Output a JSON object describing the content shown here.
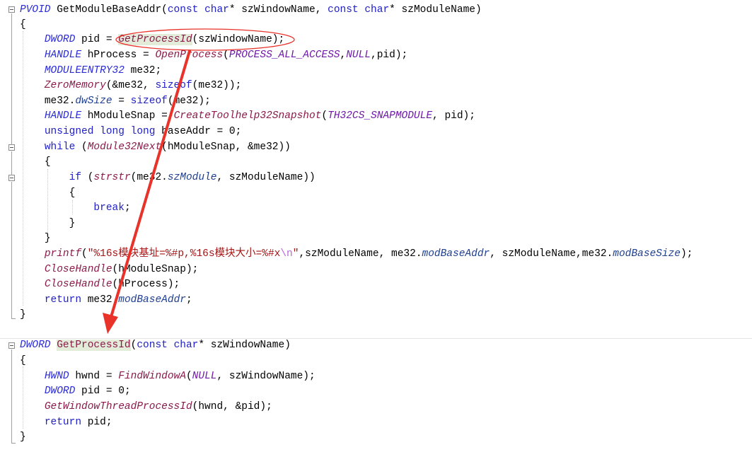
{
  "code": {
    "func1": {
      "sig": {
        "ret": "PVOID",
        "name": "GetModuleBaseAddr",
        "p1": "(",
        "kw_const1": "const",
        "kw_char1": "char",
        "ptr1": "* szWindowName, ",
        "kw_const2": "const",
        "kw_char2": "char",
        "ptr2": "* szModuleName)"
      },
      "open": "{",
      "l1": {
        "type": "DWORD",
        "text1": " pid = ",
        "call": "GetProcessId",
        "text2": "(szWindowName);"
      },
      "l2": {
        "type": "HANDLE",
        "text1": " hProcess = ",
        "call": "OpenProcess",
        "p1": "(",
        "m1": "PROCESS_ALL_ACCESS",
        "p2": ",",
        "m2": "NULL",
        "p3": ",pid);"
      },
      "l3": {
        "type": "MODULEENTRY32",
        "text1": " me32;"
      },
      "l4": {
        "call": "ZeroMemory",
        "text1": "(&me32, ",
        "kw": "sizeof",
        "text2": "(me32));"
      },
      "l5": {
        "text1": "me32.",
        "mem": "dwSize",
        "text2": " = ",
        "kw": "sizeof",
        "text3": "(me32);"
      },
      "l6": {
        "type": "HANDLE",
        "text1": " hModuleSnap = ",
        "call": "CreateToolhelp32Snapshot",
        "p1": "(",
        "m1": "TH32CS_SNAPMODULE",
        "p2": ", pid);"
      },
      "l7": {
        "kw": "unsigned long long",
        "text1": " baseAddr = 0;"
      },
      "l8": {
        "kw": "while",
        "text1": " (",
        "call": "Module32Next",
        "text2": "(hModuleSnap, &me32))"
      },
      "l9": {
        "text": "{"
      },
      "l10": {
        "kw": "if",
        "text1": " (",
        "call": "strstr",
        "text2": "(me32.",
        "mem": "szModule",
        "text3": ", szModuleName))"
      },
      "l11": {
        "text": "{"
      },
      "l12": {
        "kw": "break",
        "text1": ";"
      },
      "l13": {
        "text": "}"
      },
      "l14": {
        "text": "}"
      },
      "l15": {
        "call": "printf",
        "p1": "(",
        "str1": "\"%16s模块基址=%#p,%16s模块大小=%#x",
        "esc": "\\n",
        "str2": "\"",
        "text1": ",szModuleName, me32.",
        "mem1": "modBaseAddr",
        "text2": ", szModuleName,me32.",
        "mem2": "modBaseSize",
        "text3": ");"
      },
      "l16": {
        "call": "CloseHandle",
        "text1": "(hModuleSnap);"
      },
      "l17": {
        "call": "CloseHandle",
        "text1": "(hProcess);"
      },
      "l18": {
        "kw": "return",
        "text1": " me32.",
        "mem": "modBaseAddr",
        "text2": ";"
      },
      "close": "}"
    },
    "func2": {
      "sig": {
        "ret": "DWORD",
        "sp": " ",
        "name": "GetProcessId",
        "p1": "(",
        "kw_const": "const",
        "kw_char": "char",
        "ptr": "* szWindowName)"
      },
      "open": "{",
      "l1": {
        "type": "HWND",
        "text1": " hwnd = ",
        "call": "FindWindowA",
        "p1": "(",
        "m1": "NULL",
        "p2": ", szWindowName);"
      },
      "l2": {
        "type": "DWORD",
        "text1": " pid = 0;"
      },
      "l3": {
        "call": "GetWindowThreadProcessId",
        "text1": "(hwnd, &pid);"
      },
      "l4": {
        "kw": "return",
        "text1": " pid;"
      },
      "close": "}"
    }
  },
  "annotation": {
    "color": "#e8322a"
  }
}
